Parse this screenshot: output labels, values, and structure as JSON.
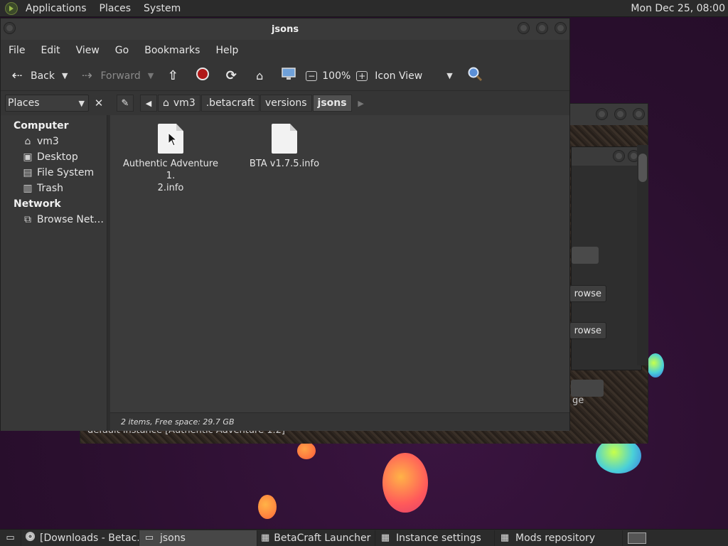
{
  "top_panel": {
    "menus": [
      "Applications",
      "Places",
      "System"
    ],
    "clock": "Mon Dec 25, 08:00"
  },
  "bg_window": {
    "browse_1": "rowse",
    "browse_2": "rowse",
    "status_text": "default instance [Authentic Adventure 1.2]",
    "fragment": "ge"
  },
  "window": {
    "title": "jsons",
    "menu": [
      "File",
      "Edit",
      "View",
      "Go",
      "Bookmarks",
      "Help"
    ],
    "toolbar": {
      "back": "Back",
      "forward": "Forward",
      "zoom": "100%",
      "view_mode": "Icon View"
    },
    "places_label": "Places",
    "breadcrumbs": [
      "vm3",
      ".betacraft",
      "versions",
      "jsons"
    ],
    "sidebar": {
      "sections": [
        {
          "title": "Computer",
          "items": [
            {
              "label": "vm3",
              "icon": "home-folder-icon"
            },
            {
              "label": "Desktop",
              "icon": "desktop-icon"
            },
            {
              "label": "File System",
              "icon": "drive-icon"
            },
            {
              "label": "Trash",
              "icon": "trash-icon"
            }
          ]
        },
        {
          "title": "Network",
          "items": [
            {
              "label": "Browse Net…",
              "icon": "network-icon"
            }
          ]
        }
      ]
    },
    "files": [
      "Authentic Adventure 1.\n2.info",
      "BTA v1.7.5.info"
    ],
    "status": "2 items, Free space: 29.7 GB"
  },
  "taskbar": {
    "tasks": [
      {
        "label": "[Downloads - Betac…",
        "icon": "chrome-icon"
      },
      {
        "label": "jsons",
        "icon": "folder-icon",
        "active": true
      },
      {
        "label": "BetaCraft Launcher …",
        "icon": "betacraft-icon"
      },
      {
        "label": "Instance settings",
        "icon": "betacraft-icon"
      },
      {
        "label": "Mods repository",
        "icon": "betacraft-icon"
      }
    ]
  }
}
